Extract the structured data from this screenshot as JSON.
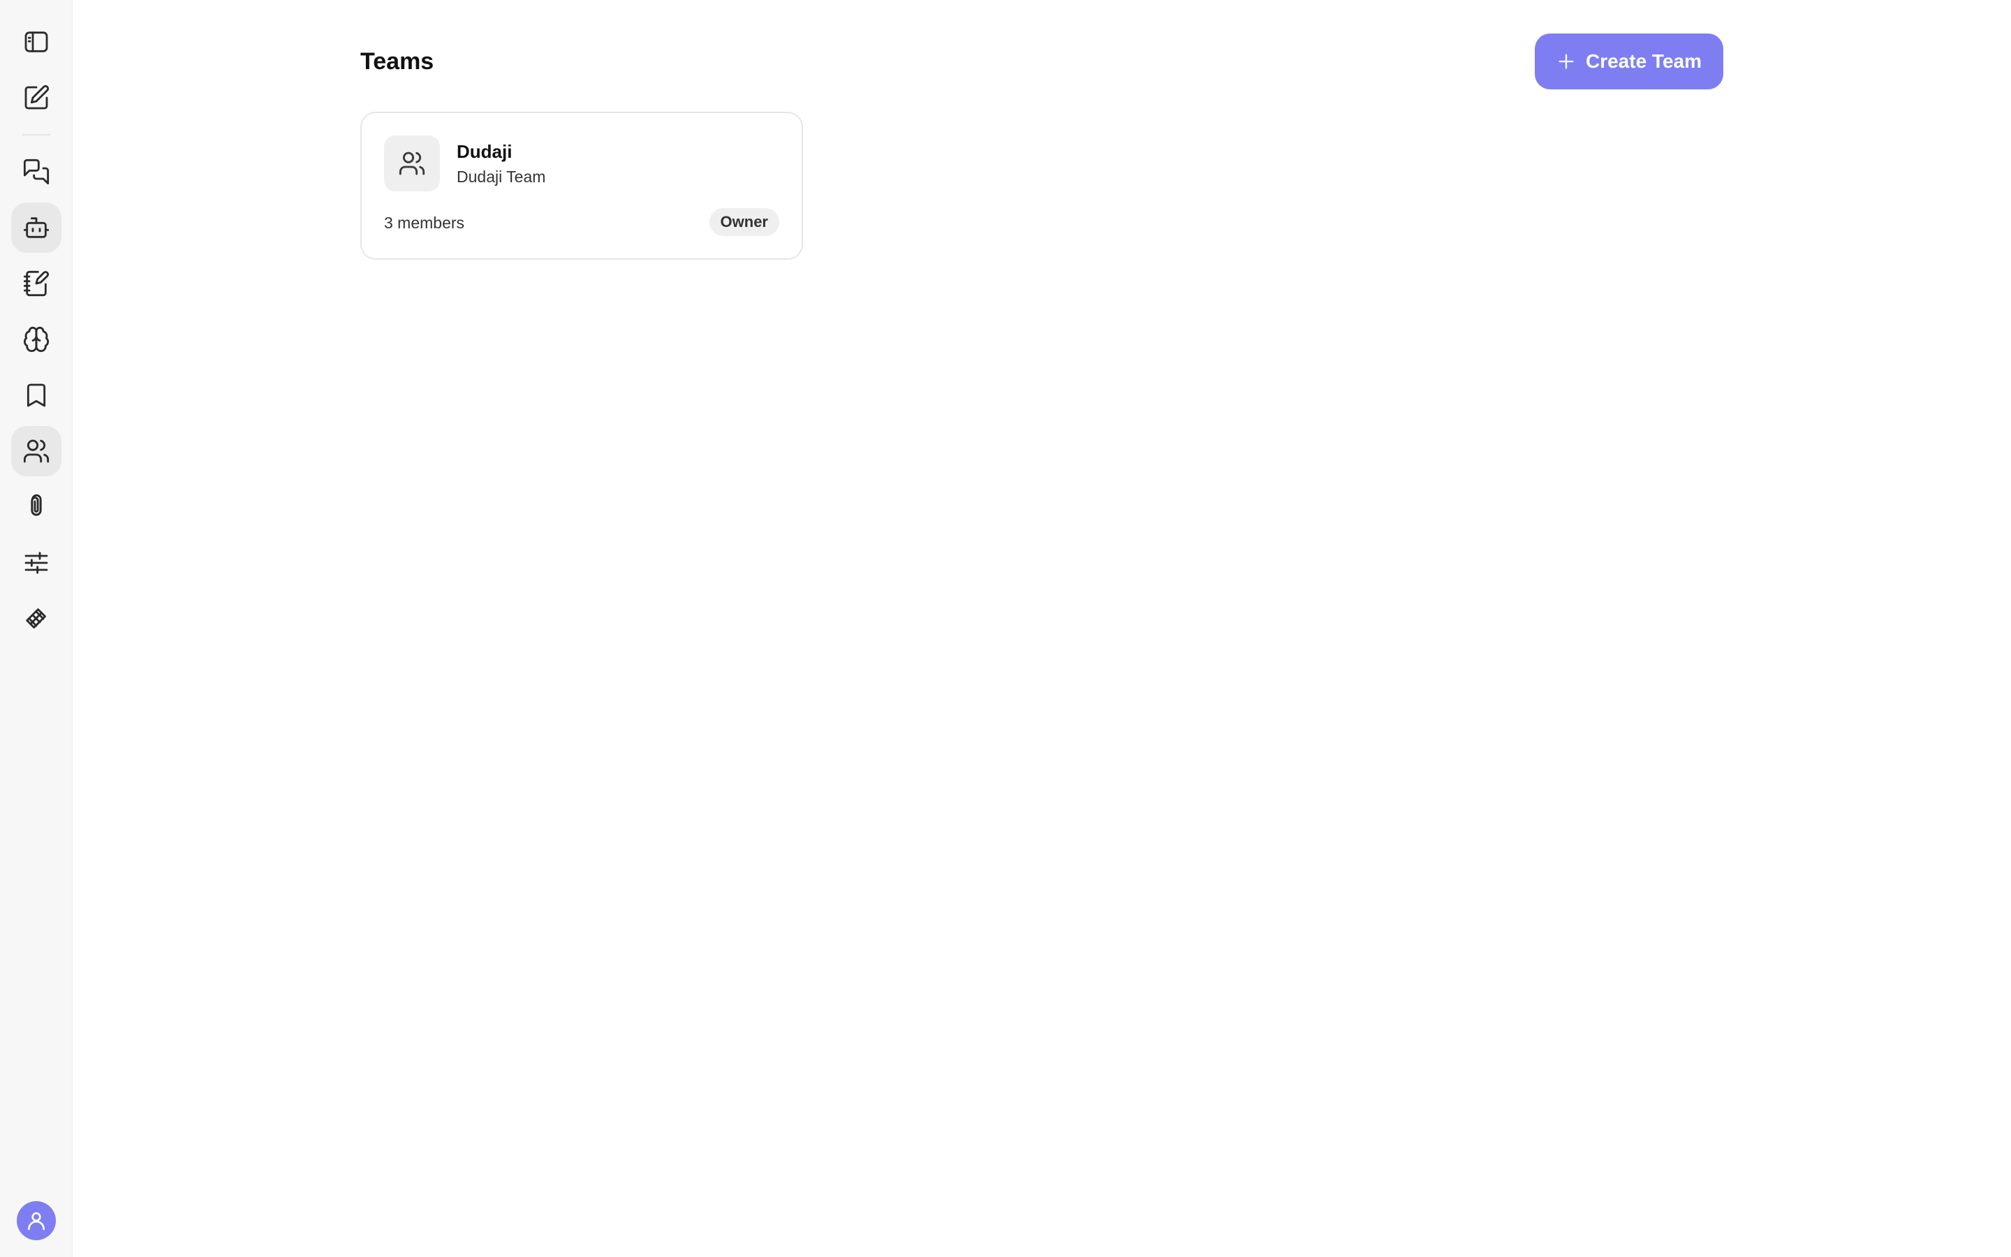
{
  "page": {
    "title": "Teams"
  },
  "actions": {
    "create_team_label": "Create Team",
    "create_team_icon": "plus-icon"
  },
  "sidebar": {
    "items": [
      {
        "id": "toggle-sidebar",
        "icon": "sidebar-toggle-icon",
        "active": false
      },
      {
        "id": "new-chat",
        "icon": "edit-icon",
        "active": false
      },
      {
        "id": "chats",
        "icon": "messages-icon",
        "active": false
      },
      {
        "id": "agents",
        "icon": "bot-icon",
        "active": true
      },
      {
        "id": "notebooks",
        "icon": "notebook-pen-icon",
        "active": false
      },
      {
        "id": "memory",
        "icon": "brain-icon",
        "active": false
      },
      {
        "id": "bookmarks",
        "icon": "bookmark-icon",
        "active": false
      },
      {
        "id": "teams",
        "icon": "users-icon",
        "active": true
      },
      {
        "id": "attachments",
        "icon": "paperclip-icon",
        "active": false
      },
      {
        "id": "settings",
        "icon": "sliders-icon",
        "active": false
      },
      {
        "id": "extensions",
        "icon": "layers-icon",
        "active": false
      }
    ],
    "profile_icon": "user-icon",
    "accent_color": "#7e7ef2"
  },
  "teams": [
    {
      "name": "Dudaji",
      "description": "Dudaji Team",
      "members": "3 members",
      "role": "Owner",
      "icon": "users-icon"
    }
  ]
}
